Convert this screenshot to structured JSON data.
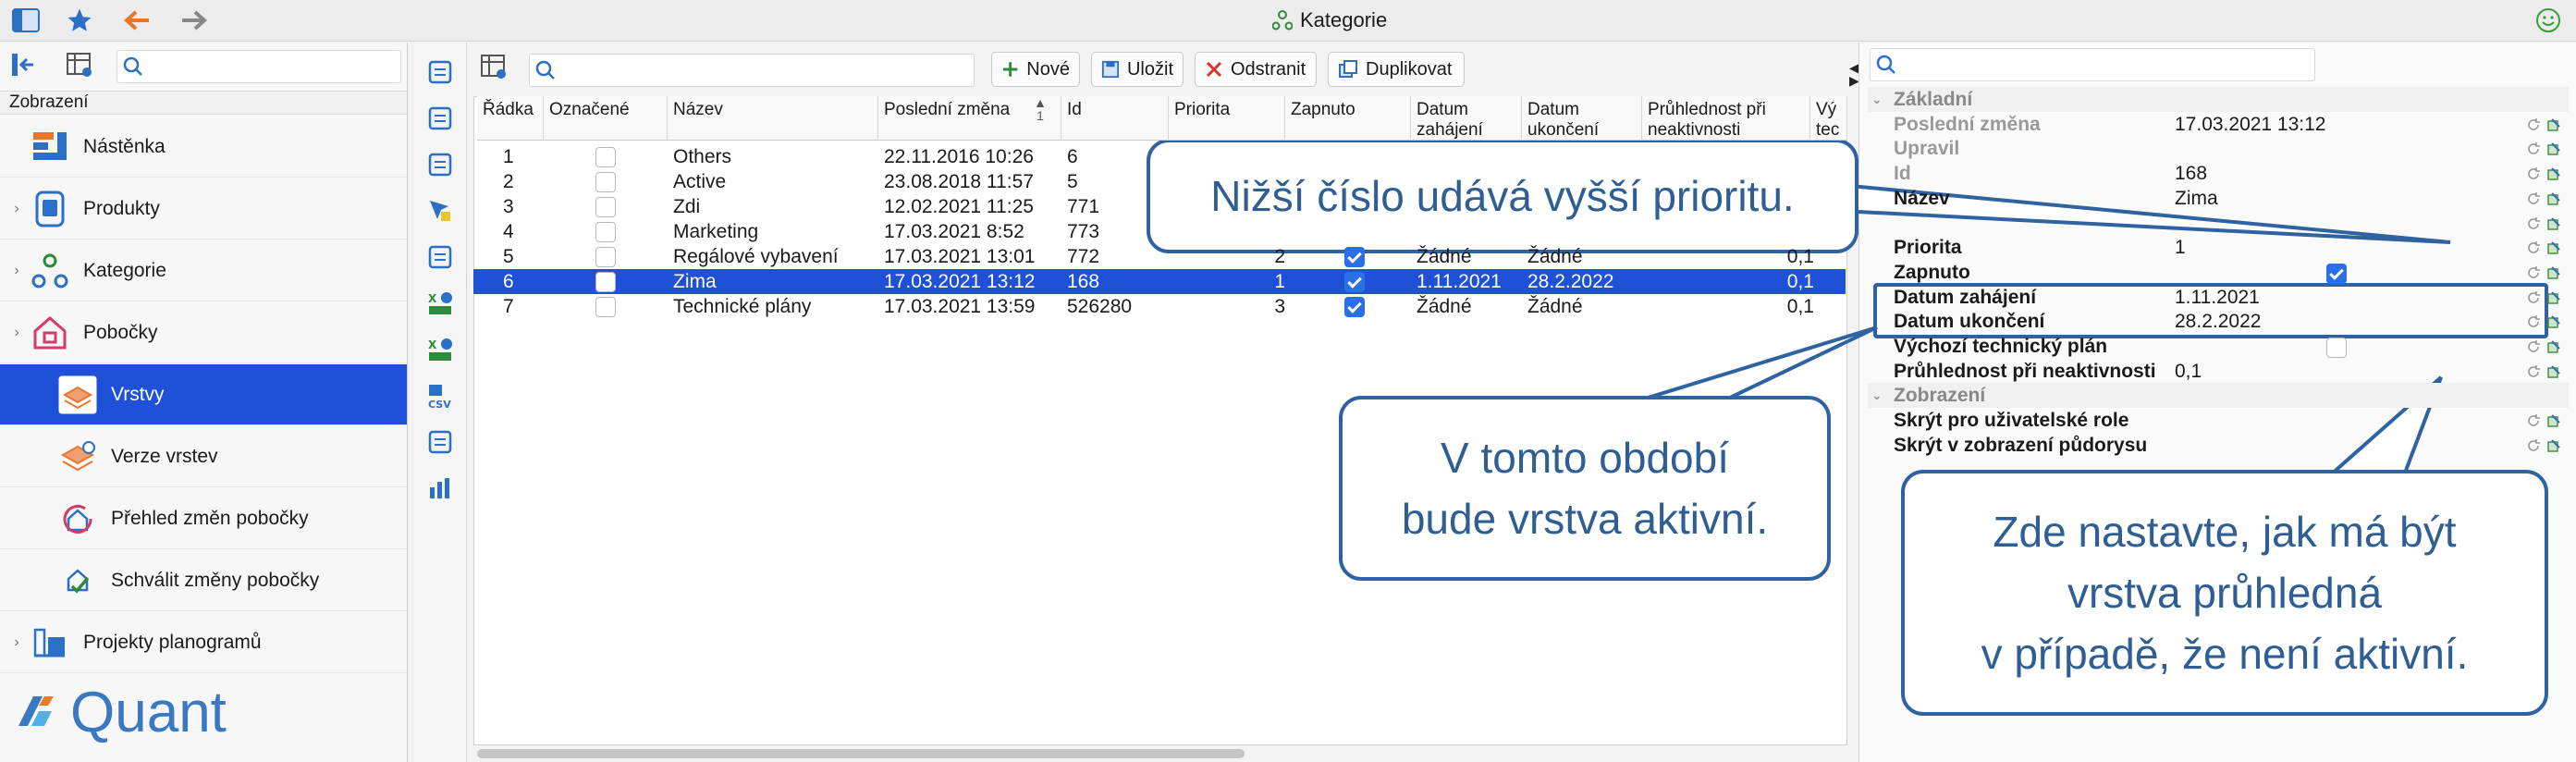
{
  "window": {
    "title": "Kategorie"
  },
  "sidebar": {
    "section_label": "Zobrazení",
    "items": [
      {
        "label": "Nástěnka",
        "icon": "dashboard-icon",
        "chevron": false,
        "selected": false
      },
      {
        "label": "Produkty",
        "icon": "products-icon",
        "chevron": true,
        "selected": false
      },
      {
        "label": "Kategorie",
        "icon": "categories-icon",
        "chevron": true,
        "selected": false
      },
      {
        "label": "Pobočky",
        "icon": "store-icon",
        "chevron": true,
        "selected": false
      },
      {
        "label": "Vrstvy",
        "icon": "layers-icon",
        "chevron": false,
        "selected": true
      },
      {
        "label": "Verze vrstev",
        "icon": "layer-versions-icon",
        "chevron": false,
        "selected": false
      },
      {
        "label": "Přehled změn pobočky",
        "icon": "store-changes-icon",
        "chevron": false,
        "selected": false
      },
      {
        "label": "Schválit změny pobočky",
        "icon": "approve-changes-icon",
        "chevron": false,
        "selected": false
      },
      {
        "label": "Projekty planogramů",
        "icon": "planogram-projects-icon",
        "chevron": true,
        "selected": false
      }
    ],
    "logo_text": "Quant"
  },
  "toolbar": {
    "new_label": "Nové",
    "save_label": "Uložit",
    "delete_label": "Odstranit",
    "duplicate_label": "Duplikovat"
  },
  "table": {
    "columns": [
      "Řádka",
      "Označené",
      "Název",
      "Poslední změna",
      "Id",
      "Priorita",
      "Zapnuto",
      "Datum zahájení",
      "Datum ukončení",
      "Průhlednost při neaktivnosti",
      "Vý tec"
    ],
    "sort_indicator": "1",
    "rows": [
      {
        "row": "1",
        "checked": false,
        "name": "Others",
        "last_change": "22.11.2016 10:26",
        "id": "6",
        "priority": "",
        "on": false,
        "start": "",
        "end": "",
        "transparency": "",
        "selected": false
      },
      {
        "row": "2",
        "checked": false,
        "name": "Active",
        "last_change": "23.08.2018 11:57",
        "id": "5",
        "priority": "",
        "on": false,
        "start": "",
        "end": "",
        "transparency": "",
        "selected": false
      },
      {
        "row": "3",
        "checked": false,
        "name": "Zdi",
        "last_change": "12.02.2021 11:25",
        "id": "771",
        "priority": "",
        "on": false,
        "start": "",
        "end": "",
        "transparency": "",
        "selected": false
      },
      {
        "row": "4",
        "checked": false,
        "name": "Marketing",
        "last_change": "17.03.2021 8:52",
        "id": "773",
        "priority": "",
        "on": false,
        "start": "",
        "end": "",
        "transparency": "",
        "selected": false
      },
      {
        "row": "5",
        "checked": false,
        "name": "Regálové vybavení",
        "last_change": "17.03.2021 13:01",
        "id": "772",
        "priority": "2",
        "on": true,
        "start": "Žádné",
        "end": "Žádné",
        "transparency": "0,1",
        "selected": false
      },
      {
        "row": "6",
        "checked": false,
        "name": "Zima",
        "last_change": "17.03.2021 13:12",
        "id": "168",
        "priority": "1",
        "on": true,
        "start": "1.11.2021",
        "end": "28.2.2022",
        "transparency": "0,1",
        "selected": true
      },
      {
        "row": "7",
        "checked": false,
        "name": "Technické plány",
        "last_change": "17.03.2021 13:59",
        "id": "526280",
        "priority": "3",
        "on": true,
        "start": "Žádné",
        "end": "Žádné",
        "transparency": "0,1",
        "selected": false
      }
    ]
  },
  "properties": {
    "rows": [
      {
        "type": "section",
        "label": "Základní"
      },
      {
        "type": "prop",
        "style": "grey",
        "label": "Poslední změna",
        "value": "17.03.2021 13:12"
      },
      {
        "type": "prop",
        "style": "grey",
        "label": "Upravil",
        "value": ""
      },
      {
        "type": "prop",
        "style": "grey",
        "label": "Id",
        "value": "168"
      },
      {
        "type": "prop",
        "style": "bold",
        "label": "Název",
        "value": "Zima"
      },
      {
        "type": "prop",
        "style": "bold",
        "label": "",
        "value": ""
      },
      {
        "type": "prop",
        "style": "bold",
        "label": "Priorita",
        "value": "1",
        "align": "right"
      },
      {
        "type": "prop",
        "style": "bold",
        "label": "Zapnuto",
        "value": "",
        "checkbox": true
      },
      {
        "type": "prop",
        "style": "bold",
        "label": "Datum zahájení",
        "value": "1.11.2021"
      },
      {
        "type": "prop",
        "style": "bold",
        "label": "Datum ukončení",
        "value": "28.2.2022"
      },
      {
        "type": "prop",
        "style": "bold",
        "label": "Výchozí technický plán",
        "value": "",
        "checkbox_off": true
      },
      {
        "type": "prop",
        "style": "bold",
        "label": "Průhlednost při neaktivnosti",
        "value": "0,1",
        "align": "right"
      },
      {
        "type": "section",
        "label": "Zobrazení"
      },
      {
        "type": "prop",
        "style": "bold",
        "label": "Skrýt pro uživatelské role",
        "value": ""
      },
      {
        "type": "prop",
        "style": "bold",
        "label": "Skrýt v zobrazení půdorysu",
        "value": ""
      }
    ]
  },
  "callouts": {
    "priority": "Nižší číslo udává vyšší prioritu.",
    "period_line1": "V tomto období",
    "period_line2": "bude vrstva aktivní.",
    "transparency_line1": "Zde nastavte, jak má být",
    "transparency_line2": "vrstva průhledná",
    "transparency_line3": "v případě, že není aktivní."
  },
  "colors": {
    "selection": "#1e50d8",
    "callout_border": "#2f62a0",
    "callout_text": "#2f5e94",
    "logo": "#3a78c2"
  }
}
